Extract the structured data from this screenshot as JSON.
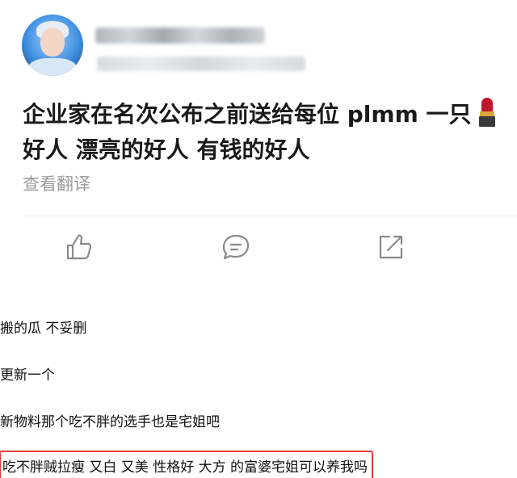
{
  "post": {
    "avatar_icon": "user-avatar",
    "text_line1": "企业家在名次公布之前送给每位 plmm 一只",
    "emoji_icon": "lipstick-emoji",
    "text_line2": "好人 漂亮的好人 有钱的好人",
    "translate_label": "查看翻译"
  },
  "actions": {
    "like_icon": "thumbs-up-icon",
    "comment_icon": "comment-icon",
    "share_icon": "share-icon"
  },
  "comments": [
    {
      "text": "搬的瓜 不妥删"
    },
    {
      "text": "更新一个"
    },
    {
      "text": "新物料那个吃不胖的选手也是宅姐吧"
    },
    {
      "text": "吃不胖贼拉瘦 又白 又美 性格好 大方 的富婆宅姐可以养我吗",
      "highlight_color": "#e33a3a"
    }
  ]
}
